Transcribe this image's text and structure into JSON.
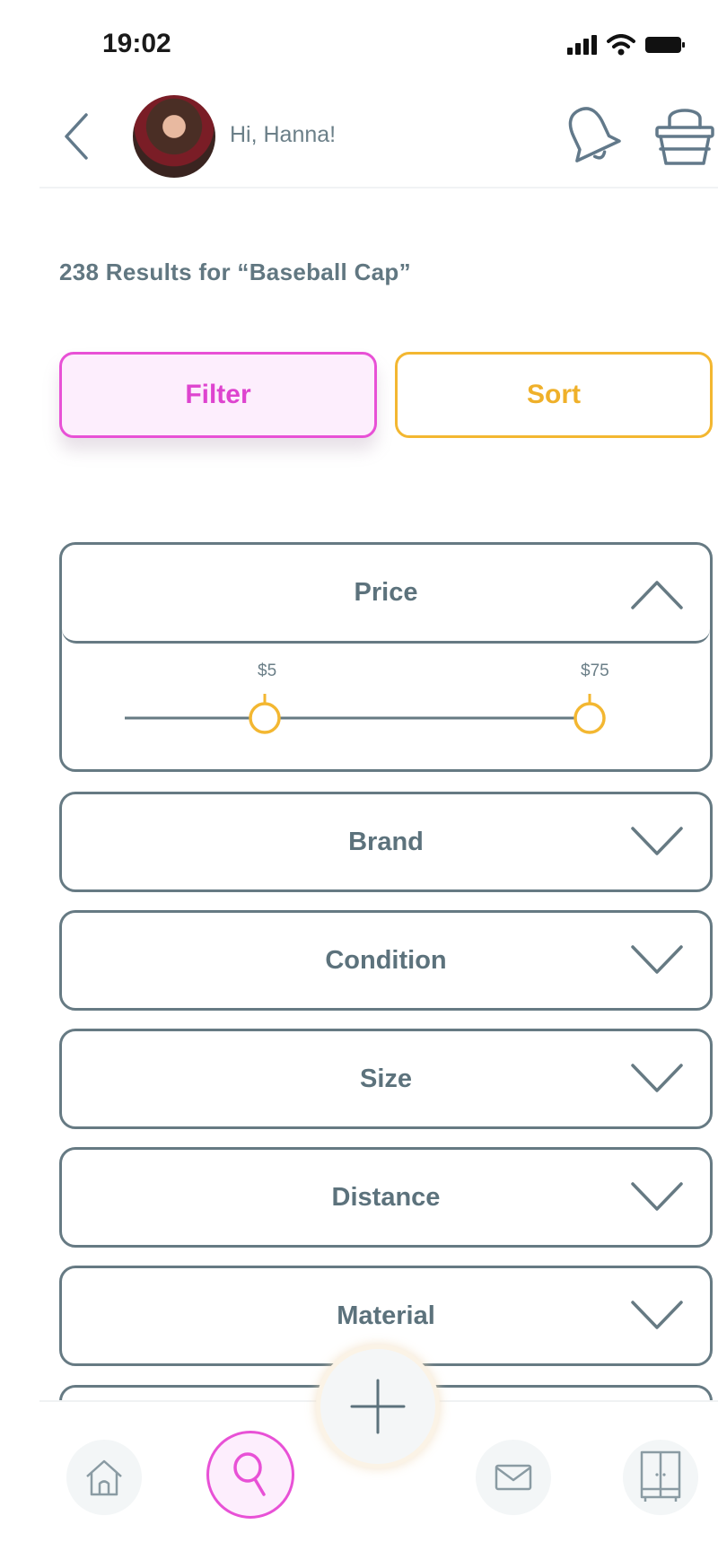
{
  "status_bar": {
    "time": "19:02"
  },
  "header": {
    "greeting": "Hi, Hanna!"
  },
  "results": {
    "title": "238 Results for “Baseball Cap”"
  },
  "actions": {
    "filter_label": "Filter",
    "sort_label": "Sort"
  },
  "filters": {
    "price": {
      "label": "Price",
      "expanded": true,
      "min_label": "$5",
      "max_label": "$75"
    },
    "brand": {
      "label": "Brand"
    },
    "condition": {
      "label": "Condition"
    },
    "size": {
      "label": "Size"
    },
    "distance": {
      "label": "Distance"
    },
    "material": {
      "label": "Material"
    }
  },
  "bottom_nav": {
    "items": [
      "home-icon",
      "search-icon",
      "add-icon",
      "mail-icon",
      "closet-icon"
    ],
    "active": "search-icon"
  },
  "colors": {
    "filter_accent": "#e851d6",
    "sort_accent": "#f3b731",
    "border": "#667a83",
    "text": "#5c727c"
  }
}
